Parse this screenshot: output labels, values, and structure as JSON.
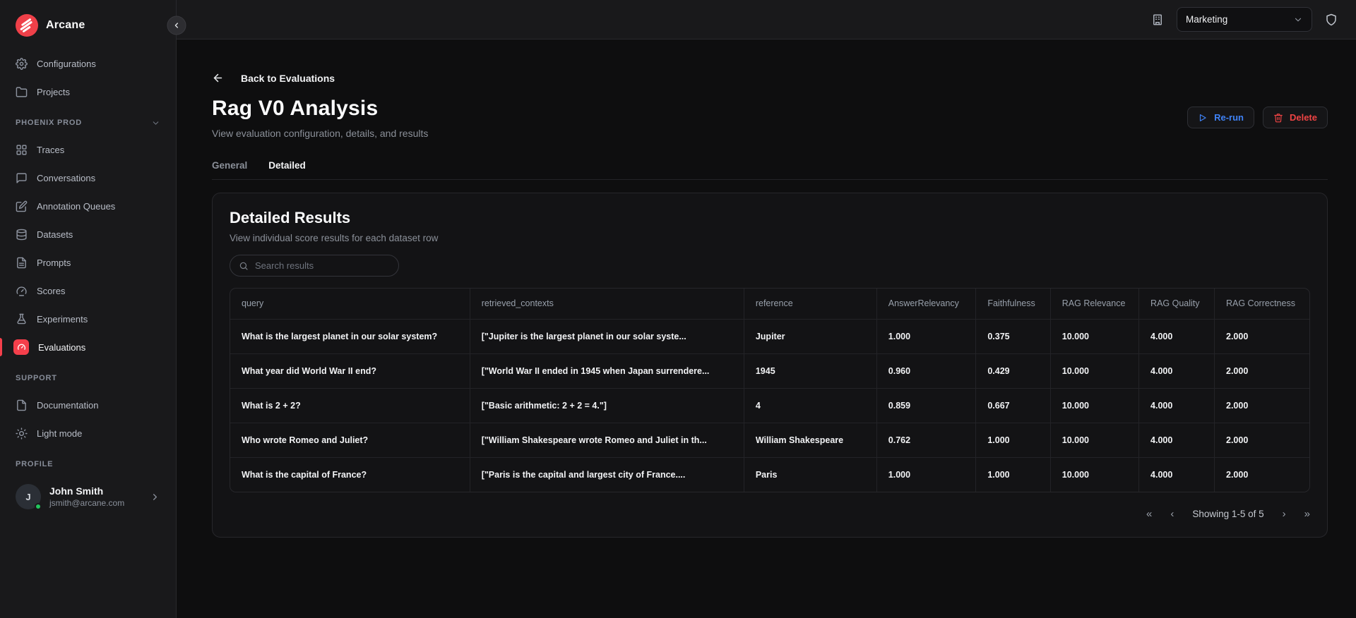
{
  "brand": {
    "name": "Arcane",
    "logo_color": "#ef4049"
  },
  "topbar": {
    "workspace": {
      "value": "Marketing"
    },
    "icons": {
      "org": "building-icon",
      "security": "shield-icon"
    }
  },
  "sidebar": {
    "groups": [
      {
        "items": [
          {
            "label": "Configurations",
            "icon": "gear-icon"
          },
          {
            "label": "Projects",
            "icon": "folder-icon"
          }
        ]
      },
      {
        "header": "PHOENIX PROD",
        "collapsible": true,
        "items": [
          {
            "label": "Traces",
            "icon": "grid-icon"
          },
          {
            "label": "Conversations",
            "icon": "chat-icon"
          },
          {
            "label": "Annotation Queues",
            "icon": "annotation-icon"
          },
          {
            "label": "Datasets",
            "icon": "database-icon"
          },
          {
            "label": "Prompts",
            "icon": "prompt-file-icon"
          },
          {
            "label": "Scores",
            "icon": "gauge-icon"
          },
          {
            "label": "Experiments",
            "icon": "flask-icon"
          },
          {
            "label": "Evaluations",
            "icon": "evaluations-gauge-icon",
            "active": true,
            "accent": "#f43f4b"
          }
        ]
      },
      {
        "header": "SUPPORT",
        "items": [
          {
            "label": "Documentation",
            "icon": "document-icon"
          },
          {
            "label": "Light mode",
            "icon": "sun-icon"
          }
        ]
      },
      {
        "header": "PROFILE"
      }
    ],
    "profile": {
      "initial": "J",
      "name": "John Smith",
      "email": "jsmith@arcane.com",
      "status_color": "#22c55e"
    }
  },
  "header": {
    "back_label": "Back to Evaluations",
    "title": "Rag V0 Analysis",
    "subtitle": "View evaluation configuration, details, and results",
    "rerun_label": "Re-run",
    "delete_label": "Delete",
    "rerun_color": "#3f82f6",
    "delete_color": "#ef4444"
  },
  "tabs": [
    {
      "label": "General",
      "active": false
    },
    {
      "label": "Detailed",
      "active": true
    }
  ],
  "card": {
    "title": "Detailed Results",
    "subtitle": "View individual score results for each dataset row",
    "search_placeholder": "Search results"
  },
  "table": {
    "columns": [
      "query",
      "retrieved_contexts",
      "reference",
      "AnswerRelevancy",
      "Faithfulness",
      "RAG Relevance",
      "RAG Quality",
      "RAG Correctness"
    ],
    "rows": [
      {
        "cells": [
          "What is the largest planet in our solar system?",
          "[\"Jupiter is the largest planet in our solar syste...",
          "Jupiter",
          "1.000",
          "0.375",
          "10.000",
          "4.000",
          "2.000"
        ]
      },
      {
        "cells": [
          "What year did World War II end?",
          "[\"World War II ended in 1945 when Japan surrendere...",
          "1945",
          "0.960",
          "0.429",
          "10.000",
          "4.000",
          "2.000"
        ]
      },
      {
        "cells": [
          "What is 2 + 2?",
          "[\"Basic arithmetic: 2 + 2 = 4.\"]",
          "4",
          "0.859",
          "0.667",
          "10.000",
          "4.000",
          "2.000"
        ]
      },
      {
        "cells": [
          "Who wrote Romeo and Juliet?",
          "[\"William Shakespeare wrote Romeo and Juliet in th...",
          "William Shakespeare",
          "0.762",
          "1.000",
          "10.000",
          "4.000",
          "2.000"
        ]
      },
      {
        "cells": [
          "What is the capital of France?",
          "[\"Paris is the capital and largest city of France....",
          "Paris",
          "1.000",
          "1.000",
          "10.000",
          "4.000",
          "2.000"
        ]
      }
    ]
  },
  "pagination": {
    "label": "Showing 1-5 of 5",
    "first_icon": "«",
    "prev_icon": "‹",
    "next_icon": "›",
    "last_icon": "»"
  }
}
